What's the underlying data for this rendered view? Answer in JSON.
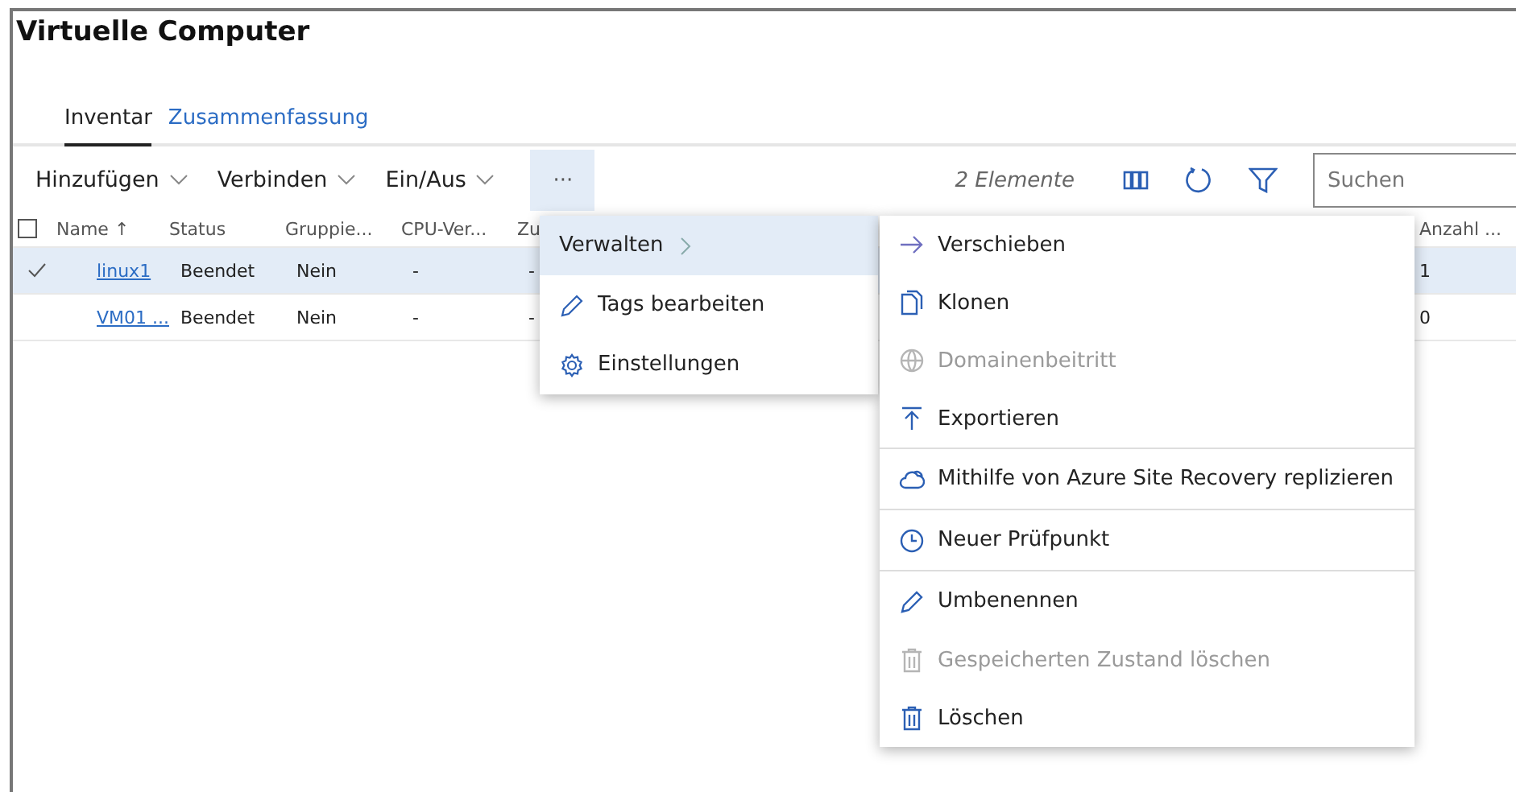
{
  "window": {
    "title": "Virtuelle Computer"
  },
  "tabs": [
    {
      "label": "Inventar",
      "selected": true
    },
    {
      "label": "Zusammenfassung",
      "selected": false
    }
  ],
  "toolbar": {
    "buttons": [
      {
        "label": "Hinzufügen"
      },
      {
        "label": "Verbinden"
      },
      {
        "label": "Ein/Aus"
      }
    ],
    "more": {
      "label": "···",
      "expanded": true
    },
    "count": "2 Elemente",
    "search": {
      "placeholder": "Suchen"
    }
  },
  "table": {
    "select_all": {
      "checked": false
    },
    "columns": [
      {
        "label": "Name ↑"
      },
      {
        "label": "Status"
      },
      {
        "label": "Gruppie..."
      },
      {
        "label": "CPU-Ver..."
      },
      {
        "label": "Zu"
      },
      {
        "label": "Anzahl ..."
      }
    ],
    "rows": [
      {
        "selected": true,
        "cells": [
          "linux1",
          "Beendet",
          "Nein",
          "-",
          "-",
          "1"
        ]
      },
      {
        "selected": false,
        "cells": [
          "VM01 ...",
          "Beendet",
          "Nein",
          "-",
          "-",
          "0"
        ]
      }
    ]
  },
  "menu": {
    "items": [
      {
        "label": "Verwalten",
        "kind": "submenu",
        "selected": true
      },
      {
        "label": "Tags bearbeiten",
        "kind": "pencil",
        "selected": false
      },
      {
        "label": "Einstellungen",
        "kind": "gear",
        "selected": false
      }
    ]
  },
  "submenu": {
    "items": [
      {
        "label": "Verschieben",
        "kind": "arrow",
        "disabled": false,
        "separator_above": false
      },
      {
        "label": "Klonen",
        "kind": "copy",
        "disabled": false,
        "separator_above": false
      },
      {
        "label": "Domainenbeitritt",
        "kind": "globe",
        "disabled": true,
        "separator_above": false
      },
      {
        "label": "Exportieren",
        "kind": "export",
        "disabled": false,
        "separator_above": false
      },
      {
        "label": "Mithilfe von Azure Site Recovery replizieren",
        "kind": "cloud",
        "disabled": false,
        "separator_above": true
      },
      {
        "label": "Neuer Prüfpunkt",
        "kind": "clock",
        "disabled": false,
        "separator_above": true
      },
      {
        "label": "Umbenennen",
        "kind": "pencil",
        "disabled": false,
        "separator_above": true
      },
      {
        "label": "Gespeicherten Zustand löschen",
        "kind": "trash",
        "disabled": true,
        "separator_above": false
      },
      {
        "label": "Löschen",
        "kind": "trash",
        "disabled": false,
        "separator_above": false
      }
    ]
  }
}
